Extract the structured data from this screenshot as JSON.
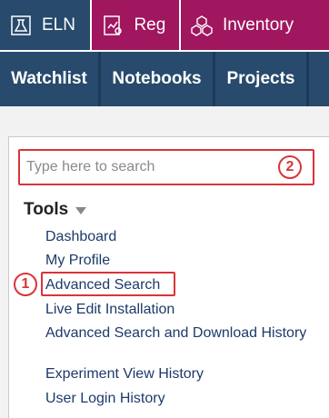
{
  "modules": [
    {
      "label": "ELN",
      "icon": "flask-icon"
    },
    {
      "label": "Reg",
      "icon": "registration-icon"
    },
    {
      "label": "Inventory",
      "icon": "boxes-icon"
    }
  ],
  "nav": {
    "items": [
      "Watchlist",
      "Notebooks",
      "Projects"
    ]
  },
  "search": {
    "placeholder": "Type here to search",
    "annotation": "2"
  },
  "tools": {
    "heading": "Tools",
    "links": [
      "Dashboard",
      "My Profile",
      "Advanced Search",
      "Live Edit Installation",
      "Advanced Search and Download History",
      "Experiment View History",
      "User Login History"
    ],
    "annotation": "1"
  },
  "colors": {
    "eln_tab": "#274a6d",
    "reg_tab": "#a0165f",
    "nav_bg": "#274a6d",
    "link": "#1d3a6b",
    "highlight": "#d9343a"
  }
}
